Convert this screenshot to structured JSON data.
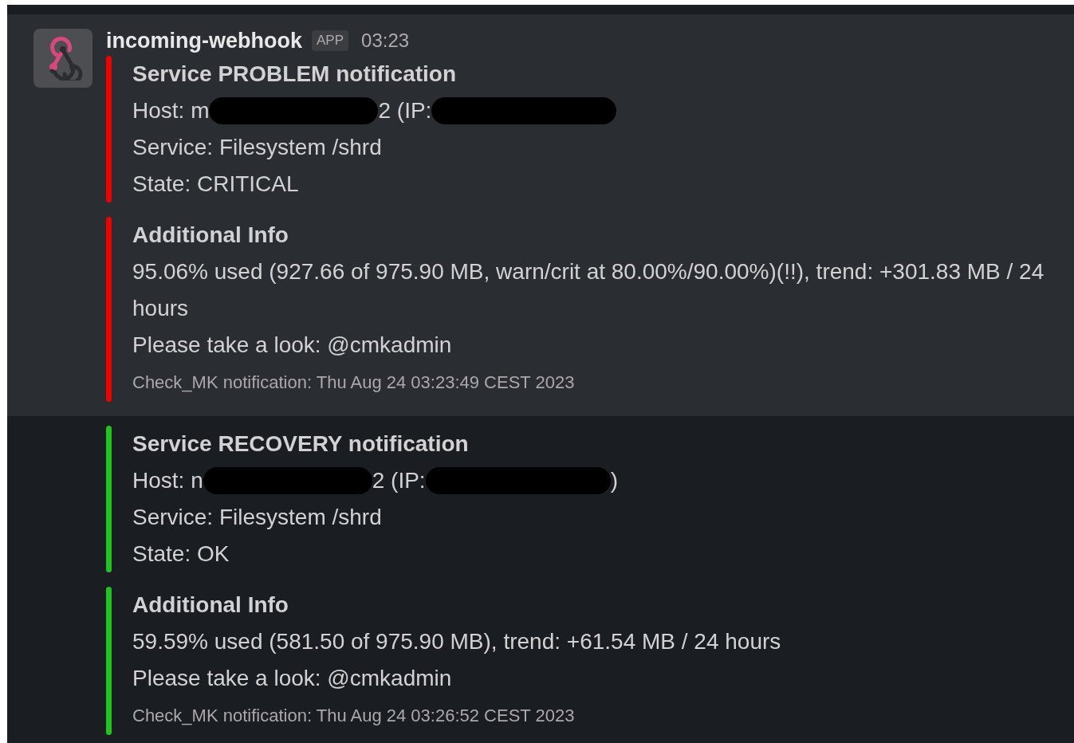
{
  "messages": [
    {
      "highlighted": true,
      "sender": {
        "name": "incoming-webhook",
        "badge": "APP",
        "time": "03:23"
      },
      "attachments": [
        {
          "color": "#f20000",
          "title": "Service PROBLEM notification",
          "lines": [
            {
              "kind": "parts",
              "parts": [
                {
                  "kind": "text",
                  "text": "Host: m"
                },
                {
                  "kind": "redacted"
                },
                {
                  "kind": "text",
                  "text": "2 (IP:"
                },
                {
                  "kind": "redacted"
                }
              ]
            },
            {
              "kind": "plain",
              "text": "Service: Filesystem /shrd"
            },
            {
              "kind": "plain",
              "text": "State: CRITICAL"
            }
          ]
        },
        {
          "color": "#f20000",
          "title": "Additional Info",
          "lines": [
            {
              "kind": "plain",
              "text": "95.06% used (927.66 of 975.90 MB, warn/crit at 80.00%/90.00%)(!!), trend: +301.83 MB / 24 hours"
            },
            {
              "kind": "plain",
              "text": "Please take a look: @cmkadmin"
            }
          ],
          "footer": "Check_MK notification: Thu Aug 24 03:23:49 CEST 2023"
        }
      ]
    },
    {
      "highlighted": false,
      "attachments": [
        {
          "color": "#1ec51e",
          "title": "Service RECOVERY notification",
          "lines": [
            {
              "kind": "parts",
              "parts": [
                {
                  "kind": "text",
                  "text": "Host: n"
                },
                {
                  "kind": "redacted"
                },
                {
                  "kind": "text",
                  "text": "2 (IP:"
                },
                {
                  "kind": "redacted"
                },
                {
                  "kind": "text",
                  "text": ")"
                }
              ]
            },
            {
              "kind": "plain",
              "text": "Service: Filesystem /shrd"
            },
            {
              "kind": "plain",
              "text": "State: OK"
            }
          ]
        },
        {
          "color": "#1ec51e",
          "title": "Additional Info",
          "lines": [
            {
              "kind": "plain",
              "text": "59.59% used (581.50 of 975.90 MB), trend: +61.54 MB / 24 hours"
            },
            {
              "kind": "plain",
              "text": "Please take a look: @cmkadmin"
            }
          ],
          "footer": "Check_MK notification: Thu Aug 24 03:26:52 CEST 2023"
        }
      ]
    }
  ]
}
